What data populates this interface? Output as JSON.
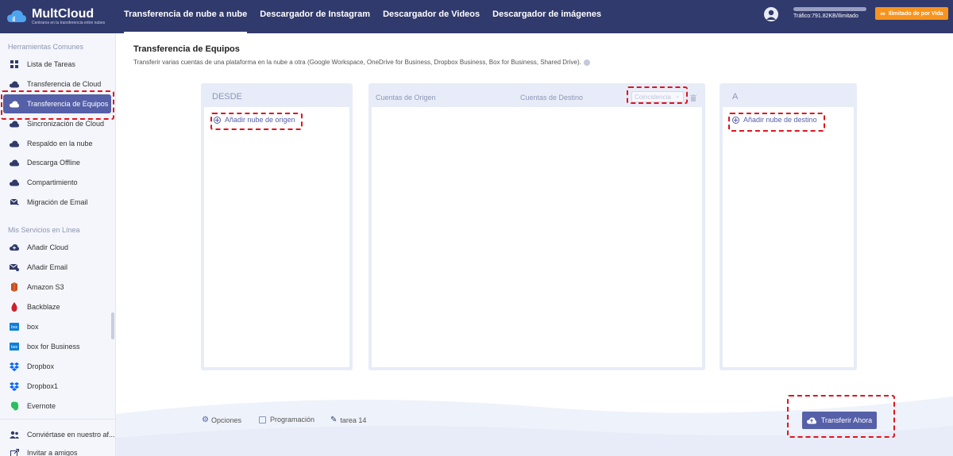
{
  "brand": {
    "name": "MultCloud",
    "tagline": "Centraros en la transferencia entre nubes"
  },
  "nav": [
    {
      "label": "Transferencia de nube a nube",
      "active": true
    },
    {
      "label": "Descargador de Instagram",
      "active": false
    },
    {
      "label": "Descargador de Videos",
      "active": false
    },
    {
      "label": "Descargador de imágenes",
      "active": false
    }
  ],
  "account": {
    "traffic": "Tráfico:791.82KB/Ilimitado",
    "upgrade_label": "Ilimitado de por Vida"
  },
  "sidebar": {
    "section1_title": "Herramientas Comunes",
    "tools": [
      {
        "label": "Lista de Tareas",
        "icon": "grid-icon"
      },
      {
        "label": "Transferencia de Cloud",
        "icon": "cloud-transfer-icon"
      },
      {
        "label": "Transferencia de Equipos",
        "icon": "team-transfer-icon",
        "active": true
      },
      {
        "label": "Sincronización de Cloud",
        "icon": "cloud-sync-icon"
      },
      {
        "label": "Respaldo en la nube",
        "icon": "cloud-backup-icon"
      },
      {
        "label": "Descarga Offline",
        "icon": "offline-download-icon"
      },
      {
        "label": "Compartimiento",
        "icon": "share-icon"
      },
      {
        "label": "Migración de Email",
        "icon": "email-migration-icon"
      }
    ],
    "section2_title": "Mis Servicios en Línea",
    "services": [
      {
        "label": "Añadir Cloud",
        "icon": "add-cloud-icon"
      },
      {
        "label": "Añadir Email",
        "icon": "add-email-icon"
      },
      {
        "label": "Amazon S3",
        "icon": "amazon-s3-icon"
      },
      {
        "label": "Backblaze",
        "icon": "backblaze-icon"
      },
      {
        "label": "box",
        "icon": "box-icon"
      },
      {
        "label": "box for Business",
        "icon": "box-business-icon"
      },
      {
        "label": "Dropbox",
        "icon": "dropbox-icon"
      },
      {
        "label": "Dropbox1",
        "icon": "dropbox-icon"
      },
      {
        "label": "Evernote",
        "icon": "evernote-icon"
      }
    ],
    "footer": [
      {
        "label": "Conviértase en nuestro af...",
        "icon": "affiliate-icon"
      },
      {
        "label": "Invitar a amigos",
        "icon": "invite-icon"
      }
    ]
  },
  "main": {
    "title": "Transferencia de Equipos",
    "description": "Transferir varias cuentas de una plataforma en la nube a otra (Google Workspace, OneDrive for Business, Dropbox Business, Box for Business, Shared Drive).",
    "source_panel": {
      "header": "DESDE",
      "add_label": "Añadir nube de origen"
    },
    "mapping_panel": {
      "col_source": "Cuentas de Origen",
      "col_dest": "Cuentas de Destino",
      "match_placeholder": "Coincidencia"
    },
    "dest_panel": {
      "header": "A",
      "add_label": "Añadir nube de destino"
    },
    "options_label": "Opciones",
    "schedule_label": "Programación",
    "task_name": "tarea 14",
    "transfer_button": "Transferir Ahora"
  },
  "colors": {
    "topbar": "#313a6c",
    "accent": "#5560a8",
    "upgrade": "#f7941d",
    "highlight": "#e0141c"
  }
}
